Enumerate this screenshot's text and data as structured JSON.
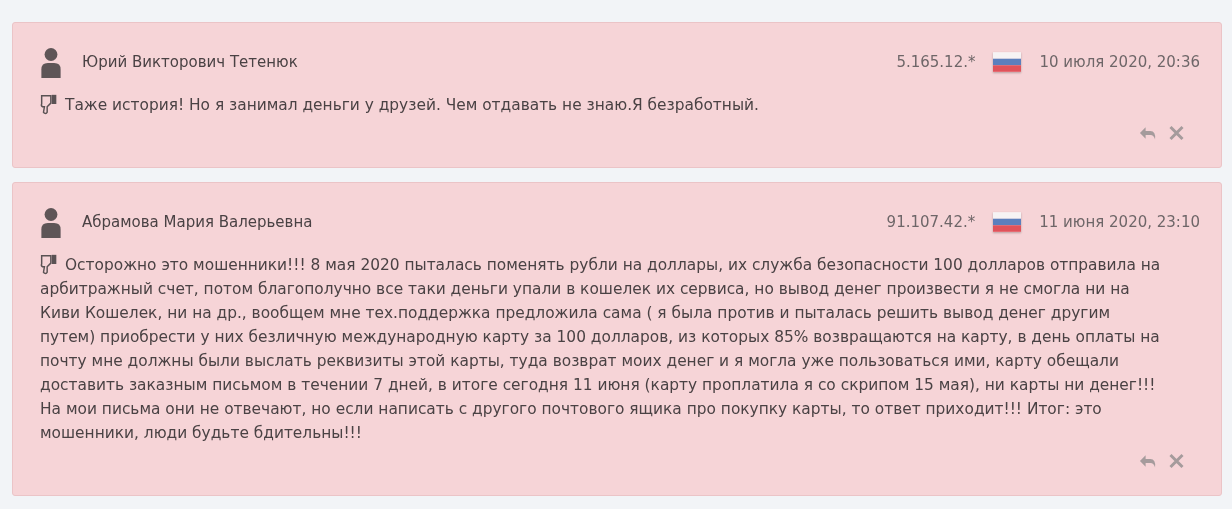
{
  "comments": [
    {
      "author": "Юрий Викторович Тетенюк",
      "ip": "5.165.12.*",
      "date": "10 июля 2020, 20:36",
      "kind": "dislike",
      "text": "Таже история! Но я занимал деньги у друзей. Чем отдавать не знаю.Я безработный."
    },
    {
      "author": "Абрамова Мария Валерьевна",
      "ip": "91.107.42.*",
      "date": "11 июня 2020, 23:10",
      "kind": "dislike",
      "text": "Осторожно это мошенники!!! 8 мая 2020 пыталась поменять рубли на доллары, их служба безопасности 100 долларов отправила на арбитражный счет, потом благополучно все таки деньги упали в кошелек их сервиса, но вывод денег произвести я не смогла ни на Киви Кошелек, ни на др., вообщем мне тех.поддержка предложила сама ( я была против и пыталась решить вывод денег другим путем) приобрести у них безличную международную карту за 100 долларов, из которых 85% возвращаются на карту, в день оплаты на почту мне должны были выслать реквизиты этой карты, туда возврат моих денег и я могла уже пользоваться ими, карту обещали доставить заказным письмом в течении 7 дней, в итоге сегодня 11 июня (карту проплатила я со скрипом 15 мая), ни карты ни денег!!! На мои письма они не отвечают, но если написать с другого почтового ящика про покупку карты, то ответ приходит!!! Итог: это мошенники, люди будьте бдительны!!!"
    }
  ]
}
